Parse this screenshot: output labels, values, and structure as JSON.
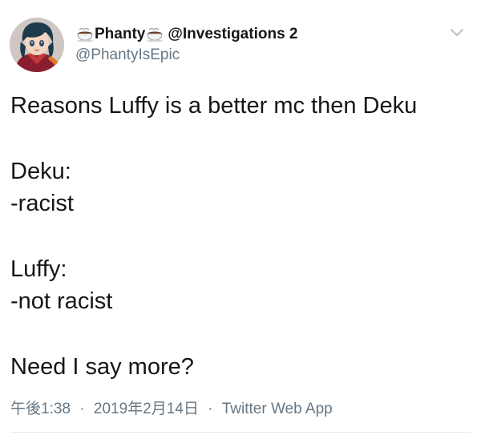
{
  "tweet": {
    "author": {
      "name_prefix_icon": "coffee-cup-icon",
      "name": "Phanty",
      "name_suffix_icon": "coffee-cup-icon",
      "name_extra": "@Investigations 2",
      "handle": "@PhantyIsEpic"
    },
    "text_lines": [
      "Reasons Luffy is a better mc then Deku",
      "",
      "Deku:",
      "-racist",
      "",
      "Luffy:",
      "-not racist",
      "",
      "Need I say more?"
    ],
    "time": "午後1:38",
    "date": "2019年2月14日",
    "source": "Twitter Web App",
    "separator": "·"
  },
  "colors": {
    "primary_text": "#14171a",
    "secondary_text": "#657786",
    "divider": "#e1e8ed"
  }
}
